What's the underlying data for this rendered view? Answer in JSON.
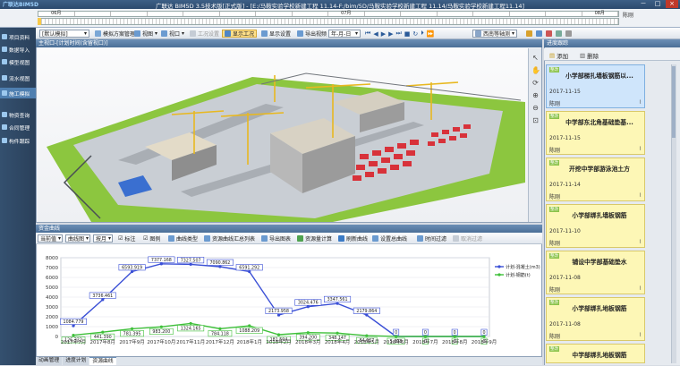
{
  "app": {
    "logo": "广联达BIM5D",
    "title": "广联达 BIM5D 3.5技术版[正式版] - [E:/马鞍实验学校新建工程 11.14-F:/bim/5D/马鞍实验学校新建工程 11.14/马鞍实验学校新建工程11.14]",
    "win_controls": [
      "－",
      "□",
      "×"
    ]
  },
  "timeline": {
    "months": [
      "06月",
      "",
      "",
      "",
      "",
      "",
      "",
      "",
      "07月",
      "",
      "",
      "",
      "",
      "",
      "",
      "08月"
    ],
    "right_label": "陈刚"
  },
  "sidebar": {
    "items": [
      {
        "label": "项目资料",
        "active": false
      },
      {
        "label": "数据导入",
        "active": false
      },
      {
        "label": "模型视图",
        "active": false
      },
      {
        "label": "流水视图",
        "active": false
      },
      {
        "label": "施工模拟",
        "active": true
      },
      {
        "label": "物资查询",
        "active": false
      },
      {
        "label": "合同管理",
        "active": false
      },
      {
        "label": "构件跟踪",
        "active": false
      }
    ]
  },
  "toolbar": {
    "mode_select": "[默认模拟]",
    "plan_manage": "模拟方案管理",
    "view": "视图",
    "viewport": "视口",
    "work_settings": "工况设置",
    "show_work": "显示工况",
    "display_settings": "显示设置",
    "export_video": "导出视频",
    "date_format": "年-月-日",
    "view_select": "西南等轴测"
  },
  "viewport": {
    "title": "主视口-[计划时间(含留视口)]"
  },
  "curve_panel": {
    "title": "资金曲线",
    "toolbar": {
      "current_data": "当前值",
      "curve_chart": "曲线图",
      "by_month": "按月",
      "annotate": "标注",
      "legend": "图例",
      "curve_type": "曲线类型",
      "resource_summary": "资源曲线汇总列表",
      "export_chart": "导出图表",
      "resource_calc": "资源量计算",
      "refresh_curve": "刷新曲线",
      "set_total": "设置总曲线",
      "time_filter": "时间过滤",
      "cancel_filter": "取消过滤"
    }
  },
  "chart_data": {
    "type": "line",
    "categories": [
      "2017年7月",
      "2017年8月",
      "2017年9月",
      "2017年10月",
      "2017年11月",
      "2017年12月",
      "2018年1月",
      "2018年2月",
      "2018年3月",
      "2018年4月",
      "2018年5月",
      "2018年6月",
      "2018年7月",
      "2018年8月",
      "2018年9月"
    ],
    "yticks": [
      "0",
      "1000",
      "2000",
      "3000",
      "4000",
      "5000",
      "6000",
      "7000",
      "8000"
    ],
    "ylim": [
      0,
      8000
    ],
    "series": [
      {
        "name": "计划-混凝土(m3)",
        "color": "#3a4fd6",
        "values": [
          1084.779,
          3736.461,
          6593.919,
          7377.168,
          7327.507,
          7090.862,
          6591.292,
          2173.958,
          3024.476,
          3347.561,
          2179.864,
          0,
          0,
          0,
          0
        ],
        "labels": [
          "1084.779",
          "3736.461",
          "6593.919",
          "7377.168",
          "7327.507",
          "7090.862",
          "6591.292",
          "2173.958",
          "3024.476",
          "3347.561",
          "2179.864",
          "0",
          "0",
          "0",
          "0"
        ]
      },
      {
        "name": "计划-钢筋(t)",
        "color": "#3fc03a",
        "values": [
          126.322,
          441.39,
          781.395,
          983.2,
          1324.165,
          784.118,
          1088.209,
          181.594,
          394.2,
          348.147,
          84.667,
          5.308,
          0,
          0,
          0
        ],
        "labels": [
          "126.322",
          "441.390",
          "781.395",
          "983.200",
          "1324.165",
          "784.118",
          "1088.209",
          "181.594",
          "394.200",
          "348.147",
          "84.667",
          "5.308",
          "0",
          "0",
          "0"
        ]
      }
    ]
  },
  "bottom_tabs": [
    "动画管理",
    "进度计划",
    "资源曲线"
  ],
  "right_panel": {
    "title": "进度跟踪",
    "add": "添加",
    "delete": "删除",
    "notes": [
      {
        "tag": "整改",
        "title": "小学部梯扎墙板钢筋以...",
        "date": "2017-11-15",
        "author": "陈刚",
        "selected": true
      },
      {
        "tag": "整改",
        "title": "中学部东北角基础垫基...",
        "date": "2017-11-15",
        "author": "陈刚",
        "selected": false
      },
      {
        "tag": "整改",
        "title": "开挖中学部游泳池土方",
        "date": "2017-11-14",
        "author": "陈刚",
        "selected": false
      },
      {
        "tag": "整改",
        "title": "小学部绑扎墙板钢筋",
        "date": "2017-11-10",
        "author": "陈刚",
        "selected": false
      },
      {
        "tag": "整改",
        "title": "铺设中学部基础垫水",
        "date": "2017-11-08",
        "author": "陈刚",
        "selected": false
      },
      {
        "tag": "整改",
        "title": "小学部绑扎地板钢筋",
        "date": "2017-11-08",
        "author": "陈刚",
        "selected": false
      },
      {
        "tag": "整改",
        "title": "中学部绑扎地板钢筋",
        "date": "",
        "author": "",
        "selected": false
      }
    ]
  }
}
